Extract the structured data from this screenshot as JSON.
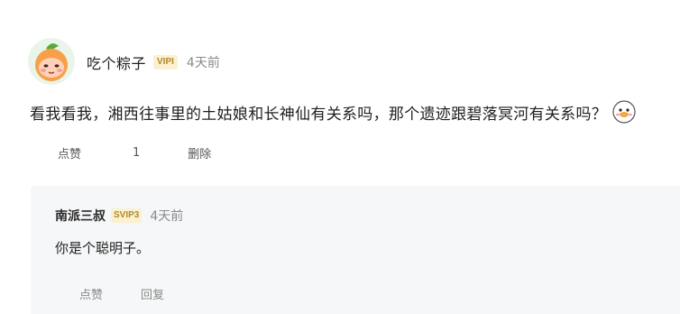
{
  "comment": {
    "username": "吃个粽子",
    "vip_badge": "VIPI",
    "time": "4天前",
    "content": "看我看我，湘西往事里的土姑娘和长神仙有关系吗，那个遗迹跟碧落冥河有关系吗？",
    "actions": {
      "like_label": "点赞",
      "like_count": "1",
      "delete_label": "删除"
    }
  },
  "reply": {
    "username": "南派三叔",
    "vip_badge": "SVIP3",
    "time": "4天前",
    "content": "你是个聪明子。",
    "actions": {
      "like_label": "点赞",
      "reply_label": "回复"
    }
  },
  "colors": {
    "vip_badge_bg": "#fbf1d0",
    "vip_badge_text": "#b08a2c",
    "reply_bg": "#f6f7f8",
    "meta_text": "#8a8a8a"
  },
  "icons": {
    "avatar": "orange-face-avatar",
    "emoji": "goose-face-emoji"
  }
}
